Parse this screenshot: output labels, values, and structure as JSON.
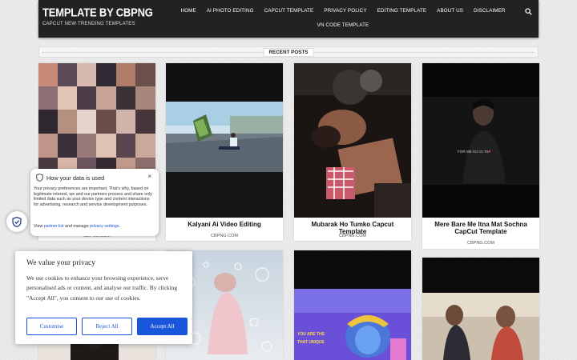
{
  "site": {
    "title": "TEMPLATE BY CBPNG",
    "tagline": "CAPCUT NEW TRENDING TEMPLATES"
  },
  "nav": {
    "items": [
      "HOME",
      "AI PHOTO EDITING",
      "CAPCUT TEMPLATE",
      "PRIVACY POLICY",
      "EDITING TEMPLATE",
      "ABOUT US",
      "DISCLAIMER",
      "VN CODE TEMPLATE"
    ],
    "search_icon": "search-icon"
  },
  "section": {
    "label": "RECENT POSTS"
  },
  "posts": [
    {
      "title": "",
      "meta": "CBPNG.COM"
    },
    {
      "title": "Kalyani Ai Video Editing",
      "meta": "CBPNG.COM"
    },
    {
      "title": "Mubarak Ho Tumko Capcut Template",
      "meta": "CBPNG.COM"
    },
    {
      "title": "Mere Bare Me Itna Mat Sochna CapCut Template",
      "meta": "CBPNG.COM"
    }
  ],
  "thumb_texts": {
    "post4_caption": "FOR ME KO GI TIL",
    "post7_caption_line1": "YOU ARE THE",
    "post7_caption_line2": "THAT UNIQUE"
  },
  "privacy_popup": {
    "title": "How your data is used",
    "body": "Your privacy preferences are important. That's why, based on legitimate interest, we and our partners process and share only limited data such as your device type and content interactions for advertising, research and service development purposes.",
    "links_prefix": "View ",
    "link1": "partner list",
    "links_middle": " and manage ",
    "link2": "privacy settings",
    "links_suffix": ".",
    "close": "×"
  },
  "cookie_banner": {
    "title": "We value your privacy",
    "body": "We use cookies to enhance your browsing experience, serve personalised ads or content, and analyse our traffic. By clicking \"Accept All\", you consent to our use of cookies.",
    "customise": "Customise",
    "reject": "Reject All",
    "accept": "Accept All"
  },
  "colors": {
    "header_bg": "#222222",
    "accent_blue": "#1a56db",
    "page_bg": "#ebebeb"
  }
}
